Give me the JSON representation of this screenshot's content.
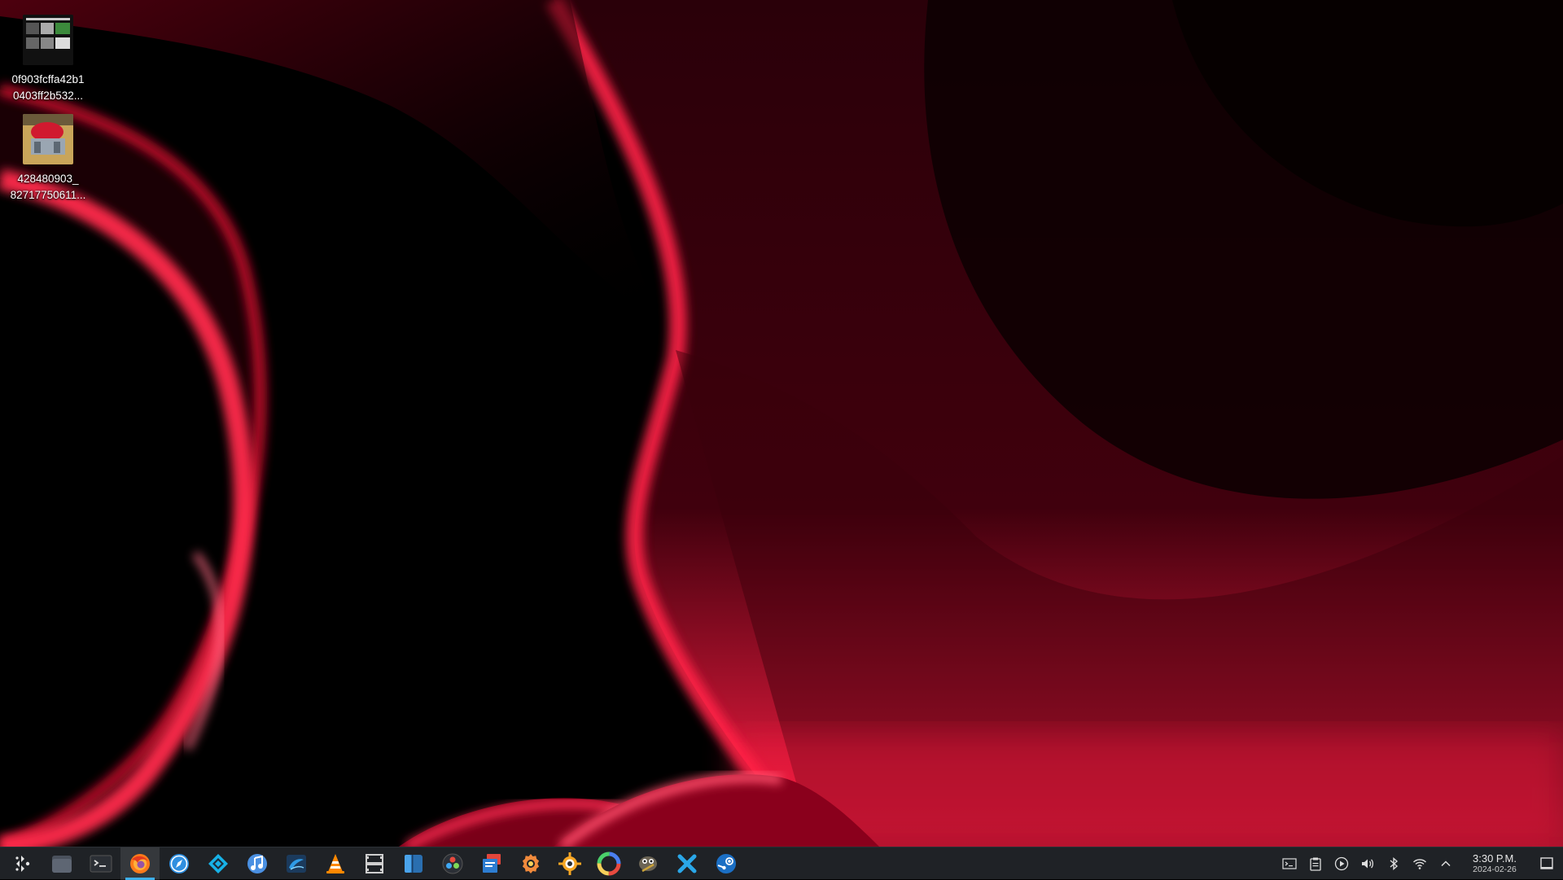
{
  "desktop": {
    "icons": [
      {
        "name_line1": "0f903fcffa42b1",
        "name_line2": "0403ff2b532..."
      },
      {
        "name_line1": "428480903_",
        "name_line2": "82717750611..."
      }
    ]
  },
  "taskbar": {
    "launchers": [
      {
        "icon": "app-launcher-icon"
      },
      {
        "icon": "file-manager-icon"
      },
      {
        "icon": "terminal-icon"
      },
      {
        "icon": "firefox-icon",
        "active": true
      },
      {
        "icon": "browser-compass-icon"
      },
      {
        "icon": "kodi-icon"
      },
      {
        "icon": "music-player-icon"
      },
      {
        "icon": "dj-app-icon"
      },
      {
        "icon": "vlc-icon"
      },
      {
        "icon": "video-editor-icon"
      },
      {
        "icon": "sidebar-app-icon"
      },
      {
        "icon": "davinci-resolve-icon"
      },
      {
        "icon": "presentation-app-icon"
      },
      {
        "icon": "settings-gear-icon"
      },
      {
        "icon": "image-viewer-icon"
      },
      {
        "icon": "color-picker-icon"
      },
      {
        "icon": "gimp-icon"
      },
      {
        "icon": "x-app-icon"
      },
      {
        "icon": "steam-icon"
      }
    ],
    "tray": [
      "console-icon",
      "clipboard-icon",
      "media-play-icon",
      "volume-icon",
      "bluetooth-icon",
      "wifi-icon",
      "expand-tray-icon"
    ],
    "clock": {
      "time": "3:30 P.M.",
      "date": "2024-02-26"
    }
  },
  "colors": {
    "wallpaper_accent": "#ff1a3c",
    "panel_bg": "#1f2226",
    "active_indicator": "#3daee9"
  }
}
